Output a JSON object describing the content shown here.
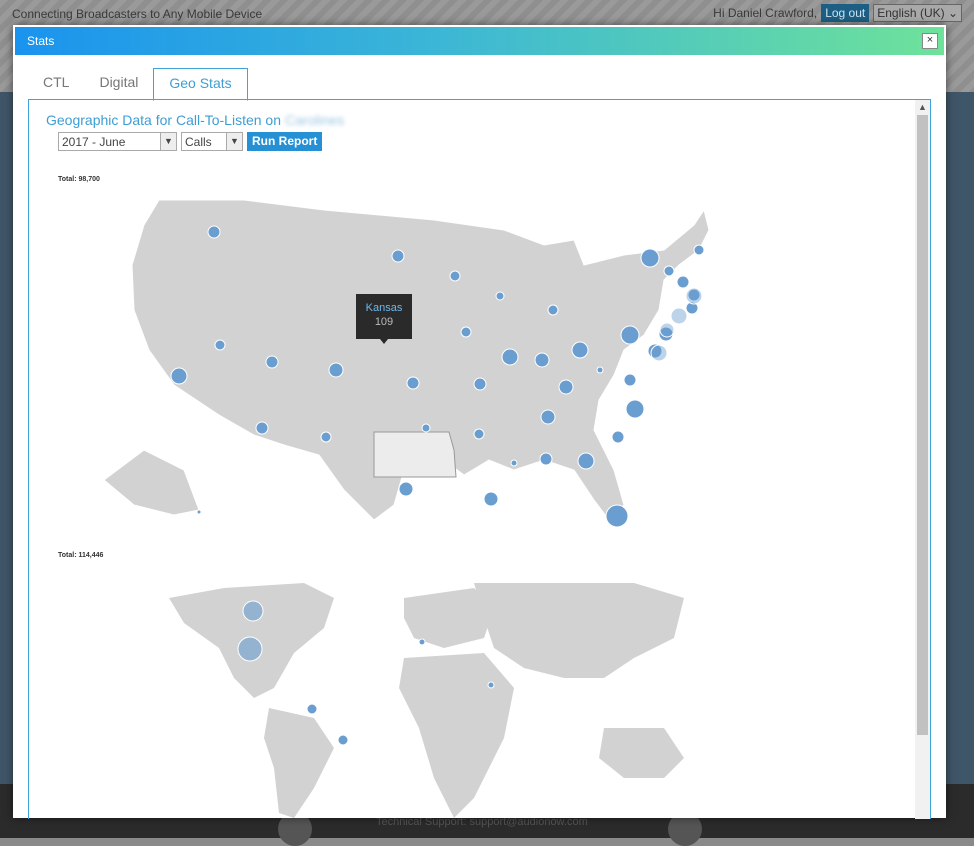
{
  "background": {
    "tagline": "Connecting Broadcasters to Any Mobile Device",
    "greeting": "Hi Daniel Crawford,",
    "logout": "Log out",
    "language": "English (UK)",
    "support": "Technical Support: support@audionow.com"
  },
  "modal": {
    "title": "Stats",
    "close": "×"
  },
  "tabs": [
    {
      "label": "CTL"
    },
    {
      "label": "Digital"
    },
    {
      "label": "Geo Stats"
    }
  ],
  "geo": {
    "heading": "Geographic Data for Call-To-Listen on",
    "station": "Carolines",
    "period_value": "2017 - June",
    "metric_value": "Calls",
    "run_label": "Run Report",
    "us_total": "Total: 98,700",
    "world_total": "Total: 114,446",
    "tooltip_state": "Kansas",
    "tooltip_value": "109"
  },
  "colors": {
    "accent": "#3e9ed4",
    "button": "#2590d3",
    "bubble": "#6a9ed0",
    "land": "#d2d2d2"
  }
}
